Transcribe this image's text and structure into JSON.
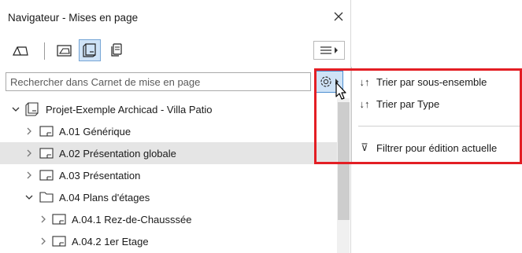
{
  "window": {
    "title": "Navigateur - Mises en page"
  },
  "search": {
    "placeholder": "Rechercher dans Carnet de mise en page"
  },
  "tree": {
    "items": [
      {
        "label": "Projet-Exemple Archicad - Villa Patio",
        "kind": "book",
        "expanded": true
      },
      {
        "label": "A.01 Générique",
        "kind": "layout"
      },
      {
        "label": "A.02 Présentation globale",
        "kind": "layout",
        "selected": true
      },
      {
        "label": "A.03 Présentation",
        "kind": "layout"
      },
      {
        "label": "A.04 Plans d'étages",
        "kind": "folder",
        "expanded": true
      },
      {
        "label": "A.04.1 Rez-de-Chausssée",
        "kind": "layout"
      },
      {
        "label": "A.04.2 1er Etage",
        "kind": "layout"
      }
    ]
  },
  "popup_menu": {
    "items": [
      {
        "icon": "↓↑",
        "label": "Trier par sous-ensemble"
      },
      {
        "icon": "↓↑",
        "label": "Trier par Type"
      },
      {
        "icon": "⊽",
        "label": "Filtrer pour édition actuelle"
      }
    ]
  },
  "colors": {
    "highlight": "#e31e24",
    "active_button": "#cfe3f7",
    "selected_row": "#e5e5e5"
  }
}
